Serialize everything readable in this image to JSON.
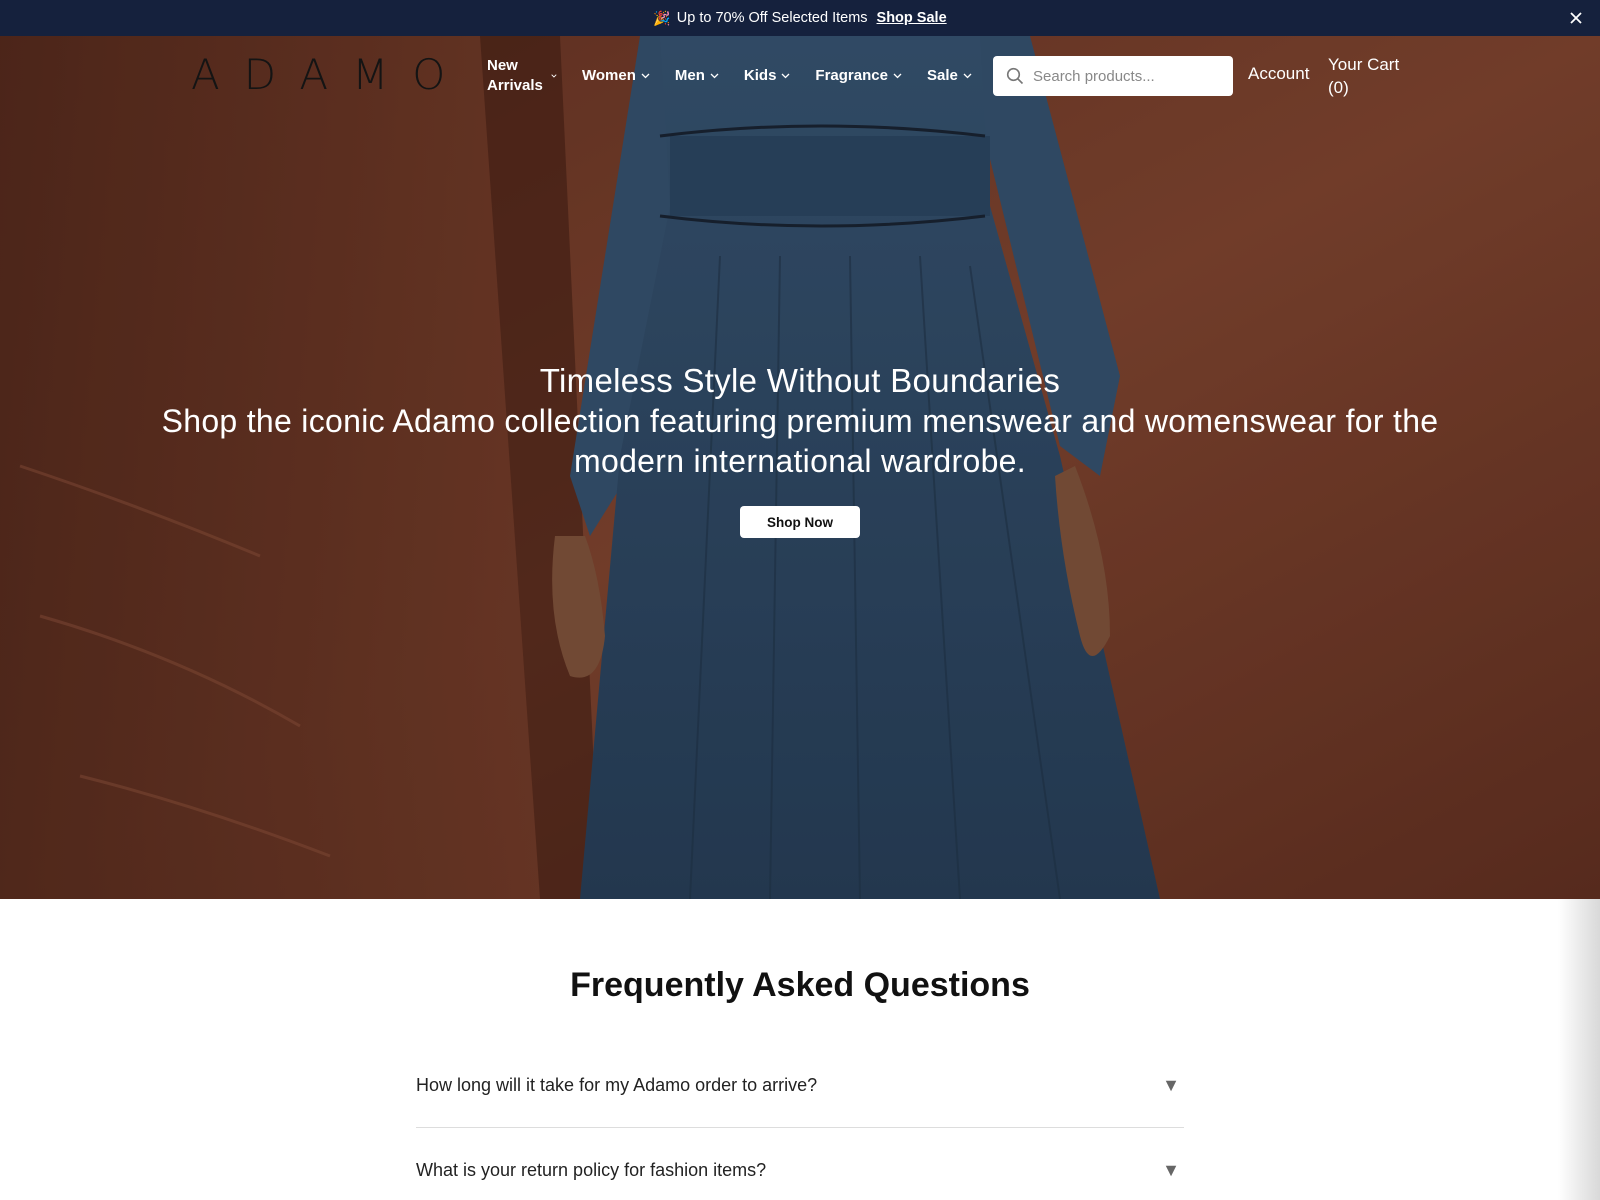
{
  "announcement": {
    "emoji": "🎉",
    "text": "Up to 70% Off Selected Items",
    "link": "Shop Sale",
    "close_icon": "close-icon"
  },
  "header": {
    "logo": "ADAMO",
    "nav": [
      {
        "label": "New Arrivals"
      },
      {
        "label": "Women"
      },
      {
        "label": "Men"
      },
      {
        "label": "Kids"
      },
      {
        "label": "Fragrance"
      },
      {
        "label": "Sale"
      }
    ],
    "search_placeholder": "Search products...",
    "account": "Account",
    "cart_label": "Your Cart",
    "cart_count": "(0)"
  },
  "hero": {
    "title": "Timeless Style Without Boundaries",
    "subtitle": "Shop the iconic Adamo collection featuring premium menswear and womenswear for the modern international wardrobe.",
    "button": "Shop Now"
  },
  "faq": {
    "title": "Frequently Asked Questions",
    "items": [
      {
        "question": "How long will it take for my Adamo order to arrive?"
      },
      {
        "question": "What is your return policy for fashion items?"
      }
    ]
  },
  "colors": {
    "announcement_bg": "#15213d",
    "hero_wall": "#7a3f2b",
    "dress": "#34516f"
  }
}
